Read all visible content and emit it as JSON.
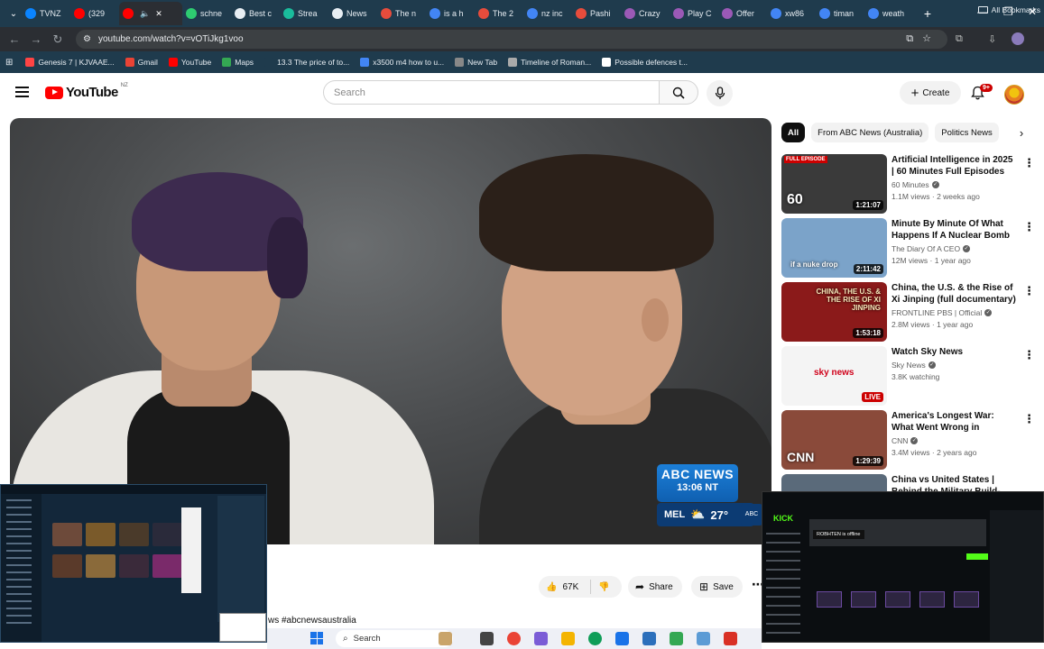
{
  "browser": {
    "tabs": [
      {
        "title": "TVNZ",
        "color": "#0a84ff",
        "active": false
      },
      {
        "title": "(329",
        "color": "#ff0000",
        "active": false
      },
      {
        "title": "",
        "color": "#ff0000",
        "active": true
      },
      {
        "title": "schne",
        "color": "#2ecc71",
        "active": false
      },
      {
        "title": "Best c",
        "color": "#e8eef3",
        "active": false
      },
      {
        "title": "Strea",
        "color": "#1abc9c",
        "active": false
      },
      {
        "title": "News",
        "color": "#e8eef3",
        "active": false
      },
      {
        "title": "The n",
        "color": "#e74c3c",
        "active": false
      },
      {
        "title": "is a h",
        "color": "#4285f4",
        "active": false
      },
      {
        "title": "The 2",
        "color": "#e74c3c",
        "active": false
      },
      {
        "title": "nz inc",
        "color": "#4285f4",
        "active": false
      },
      {
        "title": "Pashi",
        "color": "#e74c3c",
        "active": false
      },
      {
        "title": "Crazy",
        "color": "#9b59b6",
        "active": false
      },
      {
        "title": "Play C",
        "color": "#9b59b6",
        "active": false
      },
      {
        "title": "Offer",
        "color": "#9b59b6",
        "active": false
      },
      {
        "title": "xw86",
        "color": "#4285f4",
        "active": false
      },
      {
        "title": "timan",
        "color": "#4285f4",
        "active": false
      },
      {
        "title": "weath",
        "color": "#4285f4",
        "active": false
      }
    ],
    "url": "youtube.com/watch?v=vOTiJkg1voo",
    "bookmarks": [
      {
        "label": "Genesis 7 | KJVAAE...",
        "color": "#ff4444"
      },
      {
        "label": "Gmail",
        "color": "#ea4335"
      },
      {
        "label": "YouTube",
        "color": "#ff0000"
      },
      {
        "label": "Maps",
        "color": "#34a853"
      },
      {
        "label": "13.3 The price of to...",
        "color": "#1f3b4d"
      },
      {
        "label": "x3500 m4 how to u...",
        "color": "#4285f4"
      },
      {
        "label": "New Tab",
        "color": "#888888"
      },
      {
        "label": "Timeline of Roman...",
        "color": "#aaaaaa"
      },
      {
        "label": "Possible defences t...",
        "color": "#ffffff"
      }
    ],
    "all_bookmarks": "All Bookmarks"
  },
  "youtube": {
    "logo_text": "YouTube",
    "region": "NZ",
    "search_placeholder": "Search",
    "create_label": "Create",
    "notifications_badge": "9+"
  },
  "player": {
    "news_title": "ABC NEWS",
    "news_time": "13:06 NT",
    "weather_city": "MEL",
    "weather_temp": "27°",
    "channel_logo": "ABC"
  },
  "actions": {
    "likes": "67K",
    "share": "Share",
    "save": "Save",
    "hashtag": "ws #abcnewsaustralia"
  },
  "chips": [
    "All",
    "From ABC News (Australia)",
    "Politics News"
  ],
  "related": [
    {
      "title": "Artificial Intelligence in 2025 | 60 Minutes Full Episodes",
      "channel": "60 Minutes",
      "meta": "1.1M views · 2 weeks ago",
      "duration": "1:21:07",
      "thumb_bg": "#3a3a3a",
      "badge": "FULL EPISODE",
      "overlay": "60"
    },
    {
      "title": "Minute By Minute Of What Happens If A Nuclear Bomb ...",
      "channel": "The Diary Of A CEO",
      "meta": "12M views · 1 year ago",
      "duration": "2:11:42",
      "thumb_bg": "#7ba3c9",
      "badge": "",
      "overlay": "if a nuke drop"
    },
    {
      "title": "China, the U.S. & the Rise of Xi Jinping (full documentary) | ...",
      "channel": "FRONTLINE PBS | Official",
      "meta": "2.8M views · 1 year ago",
      "duration": "1:53:18",
      "thumb_bg": "#8b1a1a",
      "badge": "",
      "overlay": "CHINA, THE U.S. & THE RISE OF XI JINPING"
    },
    {
      "title": "Watch Sky News",
      "channel": "Sky News",
      "meta": "3.8K watching",
      "duration": "LIVE",
      "thumb_bg": "#f4f4f4",
      "badge": "",
      "overlay": "sky news"
    },
    {
      "title": "America's Longest War: What Went Wrong in Afghanistan ...",
      "channel": "CNN",
      "meta": "3.4M views · 2 years ago",
      "duration": "1:29:39",
      "thumb_bg": "#8a4a3a",
      "badge": "",
      "overlay": "CNN"
    },
    {
      "title": "China vs United States | Behind the Military Build-...",
      "channel": "",
      "meta": "",
      "duration": "",
      "thumb_bg": "#5a6a7a",
      "badge": "",
      "overlay": ""
    }
  ],
  "overlay_right": {
    "app": "KICK",
    "status": "ROBHTEN is offline"
  },
  "taskbar": {
    "search_label": "Search"
  }
}
